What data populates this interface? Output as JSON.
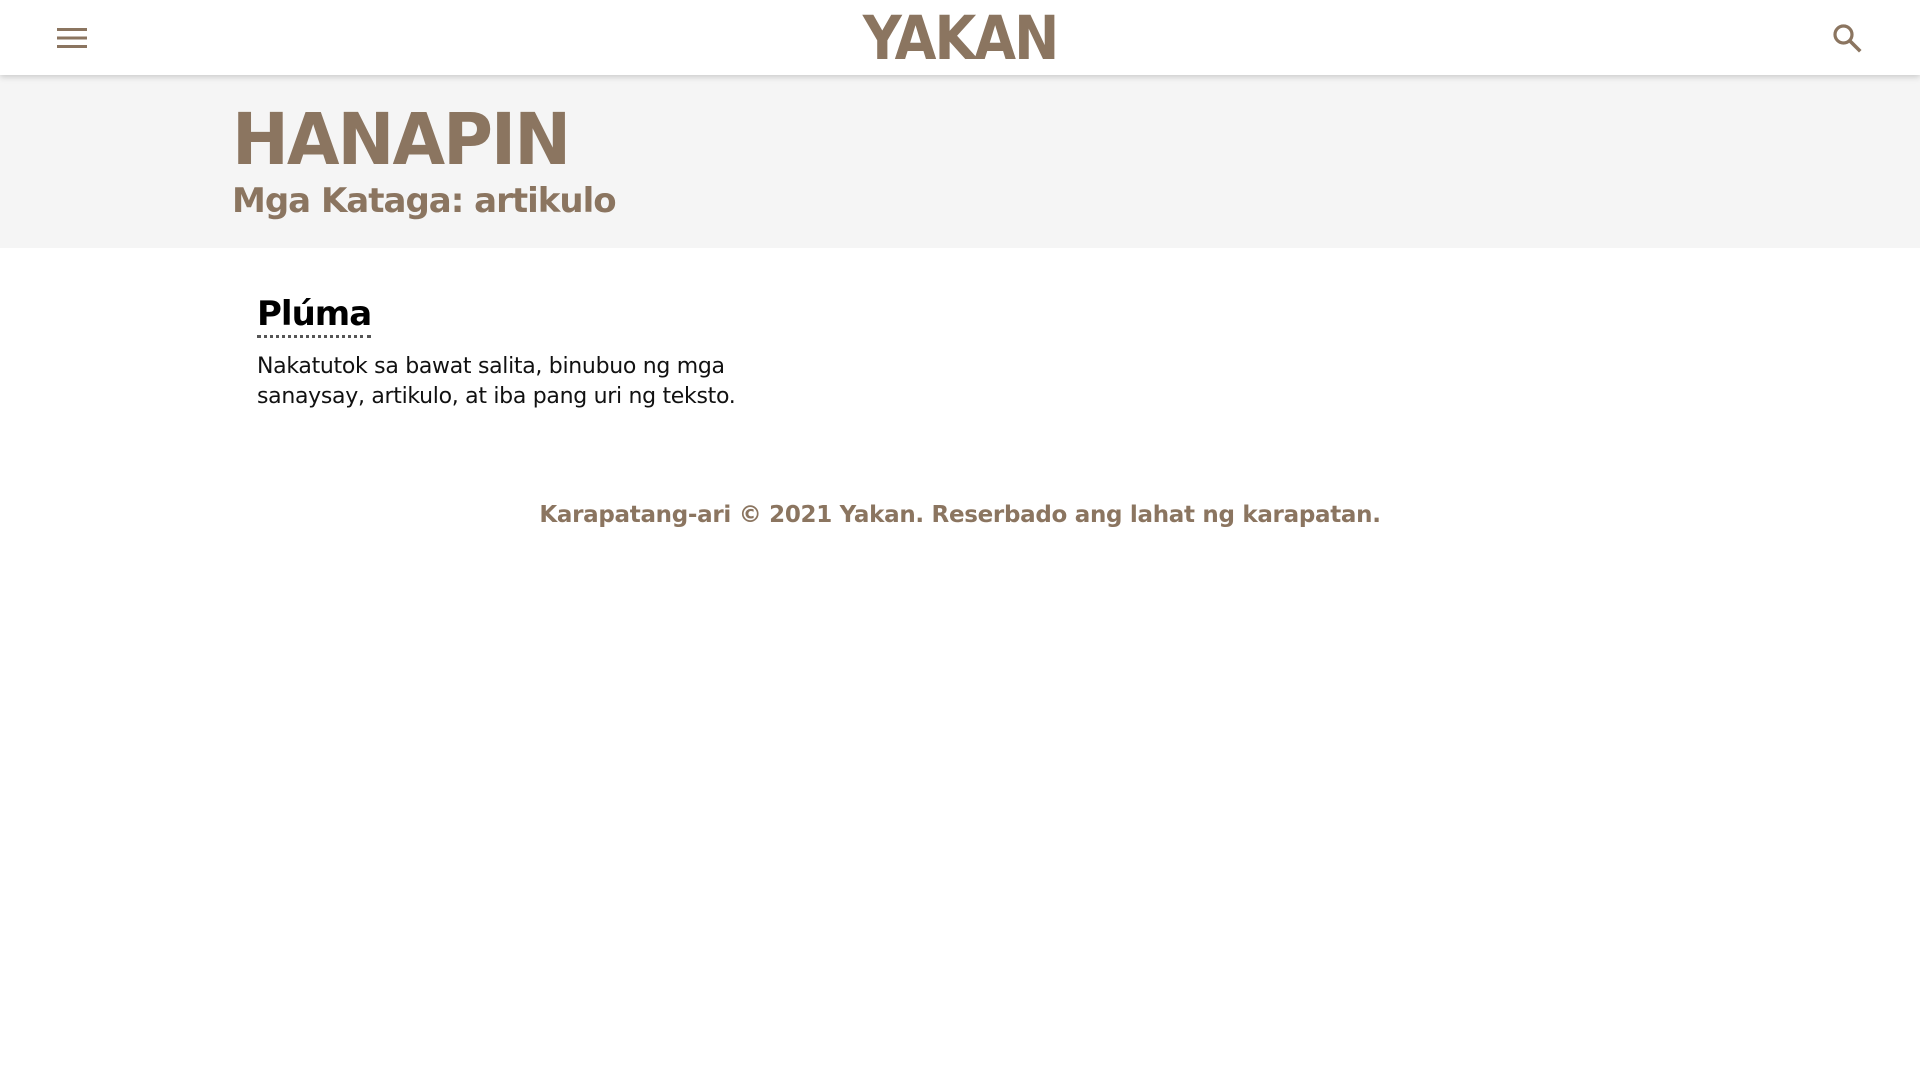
{
  "header": {
    "logo_text": "YAKAN",
    "menu_icon": "hamburger-menu-icon",
    "search_icon": "search-icon"
  },
  "hero": {
    "title": "HANAPIN",
    "subtitle": "Mga Kataga: artikulo"
  },
  "results": [
    {
      "title": "Plúma",
      "description": "Nakatutok sa bawat salita, binubuo ng mga sanaysay, artikulo, at iba pang uri ng teksto."
    }
  ],
  "footer": {
    "copyright": "Karapatang-ari © 2021 Yakan. Reserbado ang lahat ng karapatan."
  },
  "colors": {
    "brand": "#8b7560",
    "hero_background": "#f5f5f5",
    "text": "#111111"
  }
}
